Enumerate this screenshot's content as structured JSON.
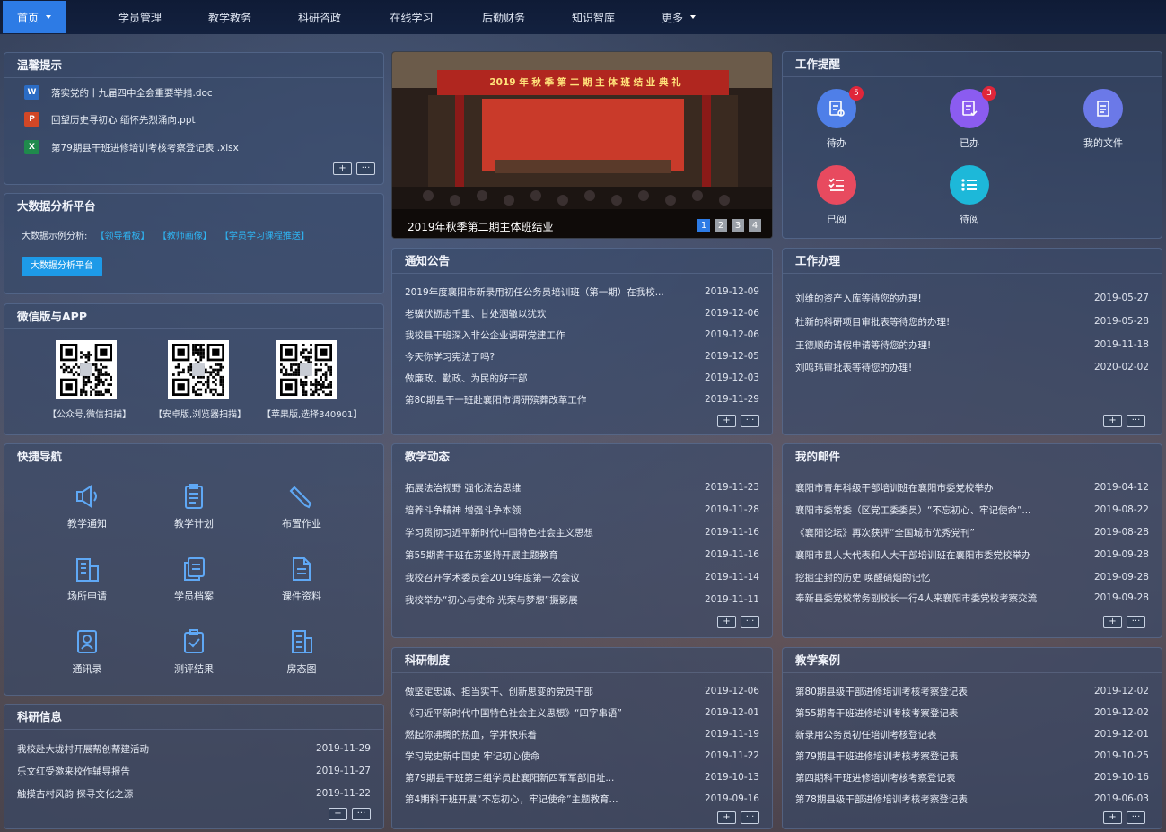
{
  "nav": {
    "items": [
      "首页",
      "学员管理",
      "教学教务",
      "科研咨政",
      "在线学习",
      "后勤财务",
      "知识智库",
      "更多"
    ]
  },
  "tips": {
    "title": "温馨提示",
    "files": [
      {
        "name": "落实党的十九届四中全会重要举措.doc",
        "type": "W",
        "color": "#2b6cc4"
      },
      {
        "name": "回望历史寻初心  缅怀先烈涌向.ppt",
        "type": "P",
        "color": "#d24726"
      },
      {
        "name": "第79期县干班进修培训考核考察登记表 .xlsx",
        "type": "X",
        "color": "#1f8a4c"
      }
    ]
  },
  "bigdata": {
    "title": "大数据分析平台",
    "example_label": "大数据示例分析:",
    "links": [
      "【领导看板】",
      "【教师画像】",
      "【学员学习课程推送】"
    ],
    "button": "大数据分析平台"
  },
  "wechat": {
    "title": "微信版与APP",
    "codes": [
      "【公众号,微信扫描】",
      "【安卓版,浏览器扫描】",
      "【苹果版,选择340901】"
    ]
  },
  "quicknav": {
    "title": "快捷导航",
    "items": [
      {
        "label": "教学通知",
        "icon": "speaker-icon"
      },
      {
        "label": "教学计划",
        "icon": "clipboard-icon"
      },
      {
        "label": "布置作业",
        "icon": "pencil-icon"
      },
      {
        "label": "场所申请",
        "icon": "building-icon"
      },
      {
        "label": "学员档案",
        "icon": "files-icon"
      },
      {
        "label": "课件资料",
        "icon": "document-icon"
      },
      {
        "label": "通讯录",
        "icon": "contact-icon"
      },
      {
        "label": "测评结果",
        "icon": "check-clipboard-icon"
      },
      {
        "label": "房态图",
        "icon": "room-icon"
      }
    ]
  },
  "research_info": {
    "title": "科研信息",
    "rows": [
      {
        "t": "我校赴大垅村开展帮创帮建活动",
        "d": "2019-11-29"
      },
      {
        "t": "乐文红受邀来校作辅导报告",
        "d": "2019-11-27"
      },
      {
        "t": "触摸古村风韵 探寻文化之源",
        "d": "2019-11-22"
      }
    ]
  },
  "banner": {
    "caption": "2019年秋季第二期主体班结业",
    "stage_text": "2019 年 秋 季 第 二 期 主 体 班 结 业 典 礼",
    "pages": [
      "1",
      "2",
      "3",
      "4"
    ]
  },
  "notice": {
    "title": "通知公告",
    "rows": [
      {
        "t": "2019年度襄阳市新录用初任公务员培训班（第一期）在我校...",
        "d": "2019-12-09"
      },
      {
        "t": "老骥伏枥志千里、甘处洇辙以犹欢",
        "d": "2019-12-06"
      },
      {
        "t": "我校县干班深入非公企业调研党建工作",
        "d": "2019-12-06"
      },
      {
        "t": "今天你学习宪法了吗?",
        "d": "2019-12-05"
      },
      {
        "t": "做廉政、勤政、为民的好干部",
        "d": "2019-12-03"
      },
      {
        "t": "第80期县干一班赴襄阳市调研殡葬改革工作",
        "d": "2019-11-29"
      }
    ]
  },
  "teaching": {
    "title": "教学动态",
    "rows": [
      {
        "t": "拓展法治视野 强化法治思维",
        "d": "2019-11-23"
      },
      {
        "t": "培养斗争精神 增强斗争本领",
        "d": "2019-11-28"
      },
      {
        "t": "学习贯彻习近平新时代中国特色社会主义思想",
        "d": "2019-11-16"
      },
      {
        "t": "第55期青干班在苏坚持开展主题教育",
        "d": "2019-11-16"
      },
      {
        "t": "我校召开学术委员会2019年度第一次会议",
        "d": "2019-11-14"
      },
      {
        "t": "我校举办“初心与使命 光荣与梦想”摄影展",
        "d": "2019-11-11"
      }
    ]
  },
  "research_sys": {
    "title": "科研制度",
    "rows": [
      {
        "t": "做坚定忠诚、担当实干、创新思变的党员干部",
        "d": "2019-12-06"
      },
      {
        "t": "《习近平新时代中国特色社会主义思想》“四字串语”",
        "d": "2019-12-01"
      },
      {
        "t": "燃起你沸腾的热血，学并快乐着",
        "d": "2019-11-19"
      },
      {
        "t": "学习党史新中国史 牢记初心使命",
        "d": "2019-11-22"
      },
      {
        "t": "第79期县干班第三组学员赴襄阳新四军军部旧址...",
        "d": "2019-10-13"
      },
      {
        "t": "第4期科干班开展“不忘初心，牢记使命”主题教育...",
        "d": "2019-09-16"
      }
    ]
  },
  "reminder": {
    "title": "工作提醒",
    "items": [
      {
        "label": "待办",
        "badge": "5",
        "color": "#4f7fe8",
        "icon": "todo-icon"
      },
      {
        "label": "已办",
        "badge": "3",
        "color": "#8b5cf0",
        "icon": "done-icon"
      },
      {
        "label": "我的文件",
        "badge": "",
        "color": "#6b79e8",
        "icon": "file-icon"
      },
      {
        "label": "已阅",
        "badge": "",
        "color": "#e84a5f",
        "icon": "read-list-icon"
      },
      {
        "label": "待阅",
        "badge": "",
        "color": "#1db8d9",
        "icon": "unread-list-icon"
      }
    ]
  },
  "work": {
    "title": "工作办理",
    "rows": [
      {
        "t": "刘维的资产入库等待您的办理!",
        "d": "2019-05-27"
      },
      {
        "t": "杜新的科研项目审批表等待您的办理!",
        "d": "2019-05-28"
      },
      {
        "t": "王德顺的请假申请等待您的办理!",
        "d": "2019-11-18"
      },
      {
        "t": "刘鸣玮审批表等待您的办理!",
        "d": "2020-02-02"
      }
    ]
  },
  "mail": {
    "title": "我的邮件",
    "rows": [
      {
        "t": "襄阳市青年科级干部培训班在襄阳市委党校举办",
        "d": "2019-04-12"
      },
      {
        "t": "襄阳市委常委（区党工委委员）“不忘初心、牢记使命”...",
        "d": "2019-08-22"
      },
      {
        "t": "《襄阳论坛》再次获评“全国城市优秀党刊”",
        "d": "2019-08-28"
      },
      {
        "t": "襄阳市县人大代表和人大干部培训班在襄阳市委党校举办",
        "d": "2019-09-28"
      },
      {
        "t": "挖掘尘封的历史 唤醒硝烟的记忆",
        "d": "2019-09-28"
      },
      {
        "t": "奉新县委党校常务副校长一行4人来襄阳市委党校考察交流",
        "d": "2019-09-28"
      }
    ]
  },
  "cases": {
    "title": "教学案例",
    "rows": [
      {
        "t": "第80期县级干部进修培训考核考察登记表",
        "d": "2019-12-02"
      },
      {
        "t": "第55期青干班进修培训考核考察登记表",
        "d": "2019-12-02"
      },
      {
        "t": "新录用公务员初任培训考核登记表",
        "d": "2019-12-01"
      },
      {
        "t": "第79期县干班进修培训考核考察登记表",
        "d": "2019-10-25"
      },
      {
        "t": "第四期科干班进修培训考核考察登记表",
        "d": "2019-10-16"
      },
      {
        "t": "第78期县级干部进修培训考核考察登记表",
        "d": "2019-06-03"
      }
    ]
  },
  "controls": {
    "plus": "+",
    "more": "···"
  }
}
